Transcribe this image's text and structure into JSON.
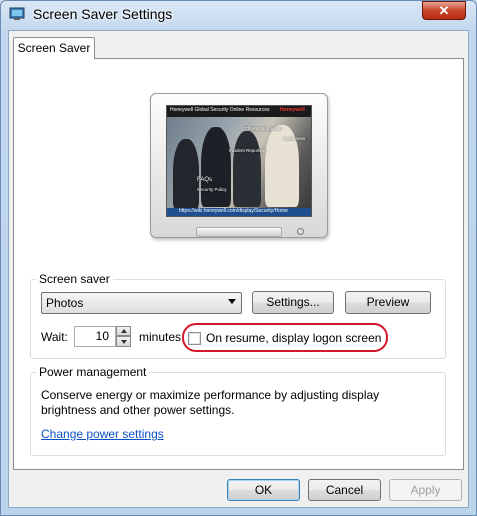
{
  "window": {
    "title": "Screen Saver Settings",
    "close_glyph": "✕"
  },
  "tabs": [
    {
      "label": "Screen Saver"
    }
  ],
  "preview": {
    "header_text": "Honeywell Global Security Online Resources",
    "brand": "Honeywell",
    "url": "https://wiki.honeywell.com/display/Security/Home",
    "labels": [
      "Threat Information",
      "Incident Reporting",
      "Awareness",
      "FAQs",
      "Security Policy"
    ]
  },
  "screen_saver": {
    "group_title": "Screen saver",
    "selected": "Photos",
    "settings_label": "Settings...",
    "preview_label": "Preview",
    "wait_label": "Wait:",
    "wait_value": "10",
    "minutes_label": "minutes",
    "resume_label": "On resume, display logon screen",
    "resume_checked": false
  },
  "power": {
    "group_title": "Power management",
    "description": "Conserve energy or maximize performance by adjusting display brightness and other power settings.",
    "link": "Change power settings"
  },
  "footer": {
    "ok": "OK",
    "cancel": "Cancel",
    "apply": "Apply"
  },
  "colors": {
    "highlight_ring": "#d6172a",
    "link": "#0b54c8",
    "close_button": "#c9452c"
  }
}
